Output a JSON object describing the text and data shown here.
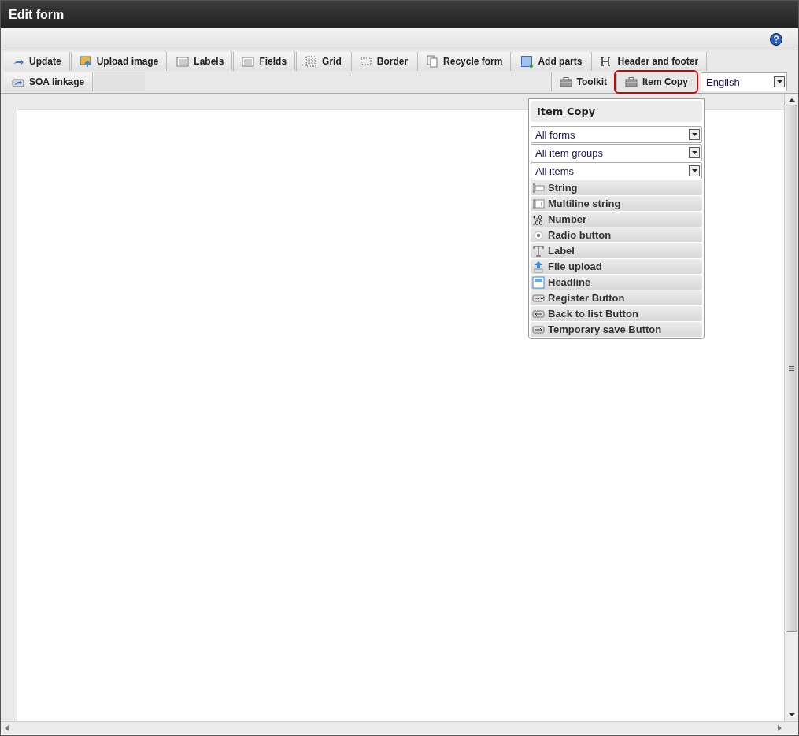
{
  "window": {
    "title": "Edit form"
  },
  "toolbar": {
    "row_1": [
      {
        "label": "Update"
      },
      {
        "label": "Upload image"
      },
      {
        "label": "Labels"
      },
      {
        "label": "Fields"
      },
      {
        "label": "Grid"
      },
      {
        "label": "Border"
      },
      {
        "label": "Recycle form"
      },
      {
        "label": "Add parts"
      },
      {
        "label": "Header and footer"
      }
    ],
    "row_2": [
      {
        "label": "SOA linkage"
      }
    ],
    "panel_tabs": [
      {
        "label": "Toolkit",
        "highlighted": false
      },
      {
        "label": "Item Copy",
        "highlighted": true
      }
    ],
    "language": {
      "value": "English"
    }
  },
  "item_copy": {
    "title": "Item Copy",
    "filters": [
      {
        "value": "All forms"
      },
      {
        "value": "All item groups"
      },
      {
        "value": "All items"
      }
    ],
    "items": [
      {
        "label": "String"
      },
      {
        "label": "Multiline string"
      },
      {
        "label": "Number"
      },
      {
        "label": "Radio button"
      },
      {
        "label": "Label"
      },
      {
        "label": "File upload"
      },
      {
        "label": "Headline"
      },
      {
        "label": "Register Button"
      },
      {
        "label": "Back to list Button"
      },
      {
        "label": "Temporary save Button"
      }
    ]
  }
}
